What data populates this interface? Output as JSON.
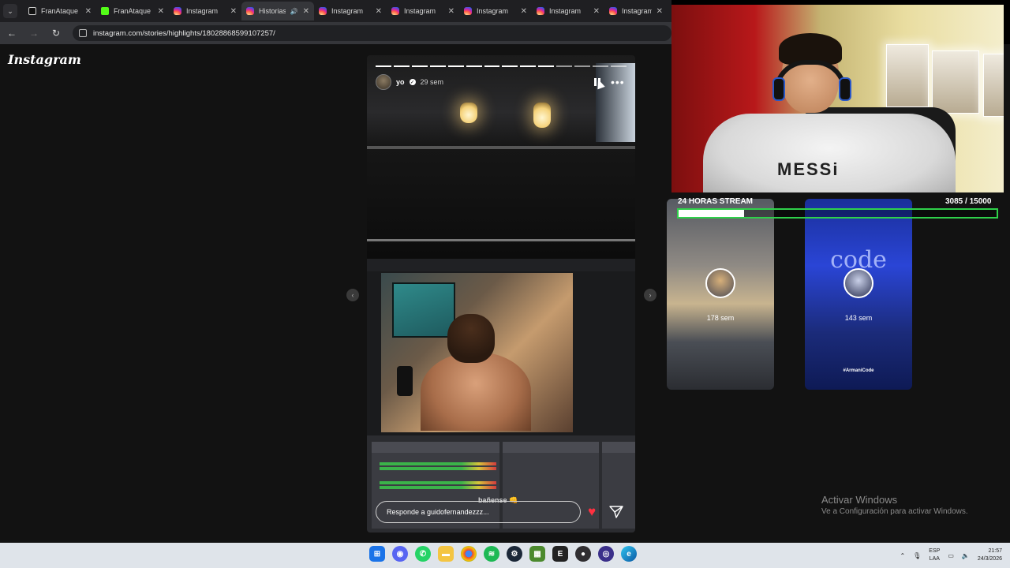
{
  "browser": {
    "tabs": [
      {
        "label": "FranAtaque",
        "icon": "tiktok-icon",
        "active": false
      },
      {
        "label": "FranAtaque",
        "icon": "kick-icon",
        "active": false
      },
      {
        "label": "Instagram",
        "icon": "instagram-icon",
        "active": false
      },
      {
        "label": "Historias",
        "icon": "instagram-icon",
        "active": true
      },
      {
        "label": "Instagram",
        "icon": "instagram-icon",
        "active": false
      },
      {
        "label": "Instagram",
        "icon": "instagram-icon",
        "active": false
      },
      {
        "label": "Instagram",
        "icon": "instagram-icon",
        "active": false
      },
      {
        "label": "Instagram",
        "icon": "instagram-icon",
        "active": false
      },
      {
        "label": "Instagram",
        "icon": "instagram-icon",
        "active": false
      }
    ],
    "url": "instagram.com/stories/highlights/18028868599107257/"
  },
  "instagram": {
    "logo": "Instagram",
    "story": {
      "username": "yo",
      "age": "29 sem",
      "segments_total": 14,
      "segments_done": 10,
      "reply_placeholder": "Responde a guidofernandezzz...",
      "caption": "bañense 👊"
    },
    "next_stories": [
      {
        "age": "178 sem"
      },
      {
        "age": "143 sem",
        "overlay_word": "code",
        "tag": "#ArmaniCode"
      }
    ]
  },
  "stream_overlay": {
    "goal_label": "24 HORAS STREAM",
    "goal_value": "3085  / 15000",
    "goal_progress": 0.2057,
    "shirt_text": "MESSi"
  },
  "windows": {
    "watermark_title": "Activar Windows",
    "watermark_sub": "Ve a Configuración para activar Windows.",
    "lang_top": "ESP",
    "lang_bottom": "LAA",
    "time": "21:57",
    "date": "24/3/2026"
  },
  "colors": {
    "goal_border": "#2fd14a",
    "like": "#ff3040",
    "taskbar": "#dfe4ea"
  }
}
